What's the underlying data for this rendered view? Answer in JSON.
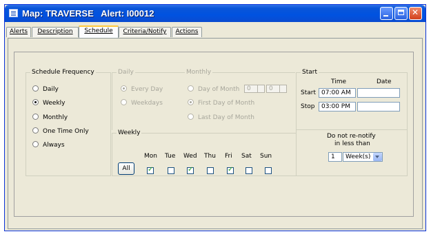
{
  "window": {
    "title": "Map: TRAVERSE   Alert: I00012"
  },
  "tabs": [
    "Alerts",
    "Description",
    "Schedule",
    "Criteria/Notify",
    "Actions"
  ],
  "active_tab": "Schedule",
  "schedule_frequency": {
    "legend": "Schedule Frequency",
    "options": [
      "Daily",
      "Weekly",
      "Monthly",
      "One Time Only",
      "Always"
    ],
    "selected": "Weekly"
  },
  "daily": {
    "legend": "Daily",
    "options": [
      "Every Day",
      "Weekdays"
    ],
    "selected": "Every Day",
    "enabled": false
  },
  "monthly": {
    "legend": "Monthly",
    "day_of_month_label": "Day of Month",
    "day_value": "0",
    "second_value": "0",
    "first_day_label": "First Day of Month",
    "last_day_label": "Last Day of Month",
    "selected": "First Day of Month",
    "enabled": false
  },
  "weekly": {
    "legend": "Weekly",
    "all_button": "All",
    "days": [
      {
        "label": "Mon",
        "checked": true
      },
      {
        "label": "Tue",
        "checked": false
      },
      {
        "label": "Wed",
        "checked": true
      },
      {
        "label": "Thu",
        "checked": false
      },
      {
        "label": "Fri",
        "checked": true
      },
      {
        "label": "Sat",
        "checked": false
      },
      {
        "label": "Sun",
        "checked": false
      }
    ]
  },
  "start": {
    "legend": "Start",
    "time_header": "Time",
    "date_header": "Date",
    "start_label": "Start",
    "stop_label": "Stop",
    "start_time": "07:00 AM",
    "start_date": "",
    "stop_time": "03:00 PM",
    "stop_date": ""
  },
  "renotify": {
    "label_line1": "Do not re-notify",
    "label_line2": "in less than",
    "value": "1",
    "unit": "Week(s)"
  }
}
